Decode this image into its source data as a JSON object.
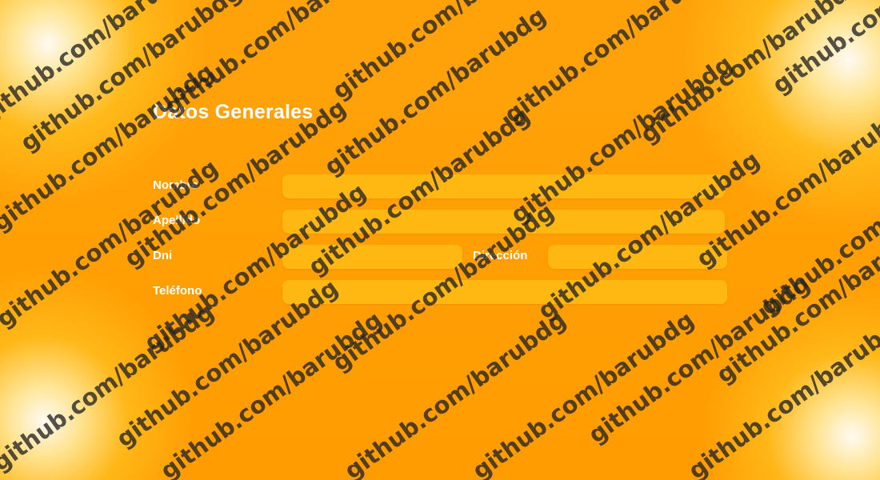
{
  "form": {
    "title": "Datos Generales",
    "fields": {
      "nombre": {
        "label": "Nombre",
        "value": ""
      },
      "apellido": {
        "label": "Apellido",
        "value": ""
      },
      "dni": {
        "label": "Dni",
        "value": ""
      },
      "direccion": {
        "label": "Dirección",
        "value": ""
      },
      "telefono": {
        "label": "Teléfono",
        "value": ""
      }
    }
  },
  "watermark": {
    "text": "github.com/barubdg"
  },
  "colors": {
    "background": "#ff9f05",
    "field": "#ffb812",
    "text": "#ffffff",
    "watermark": "#232323"
  }
}
